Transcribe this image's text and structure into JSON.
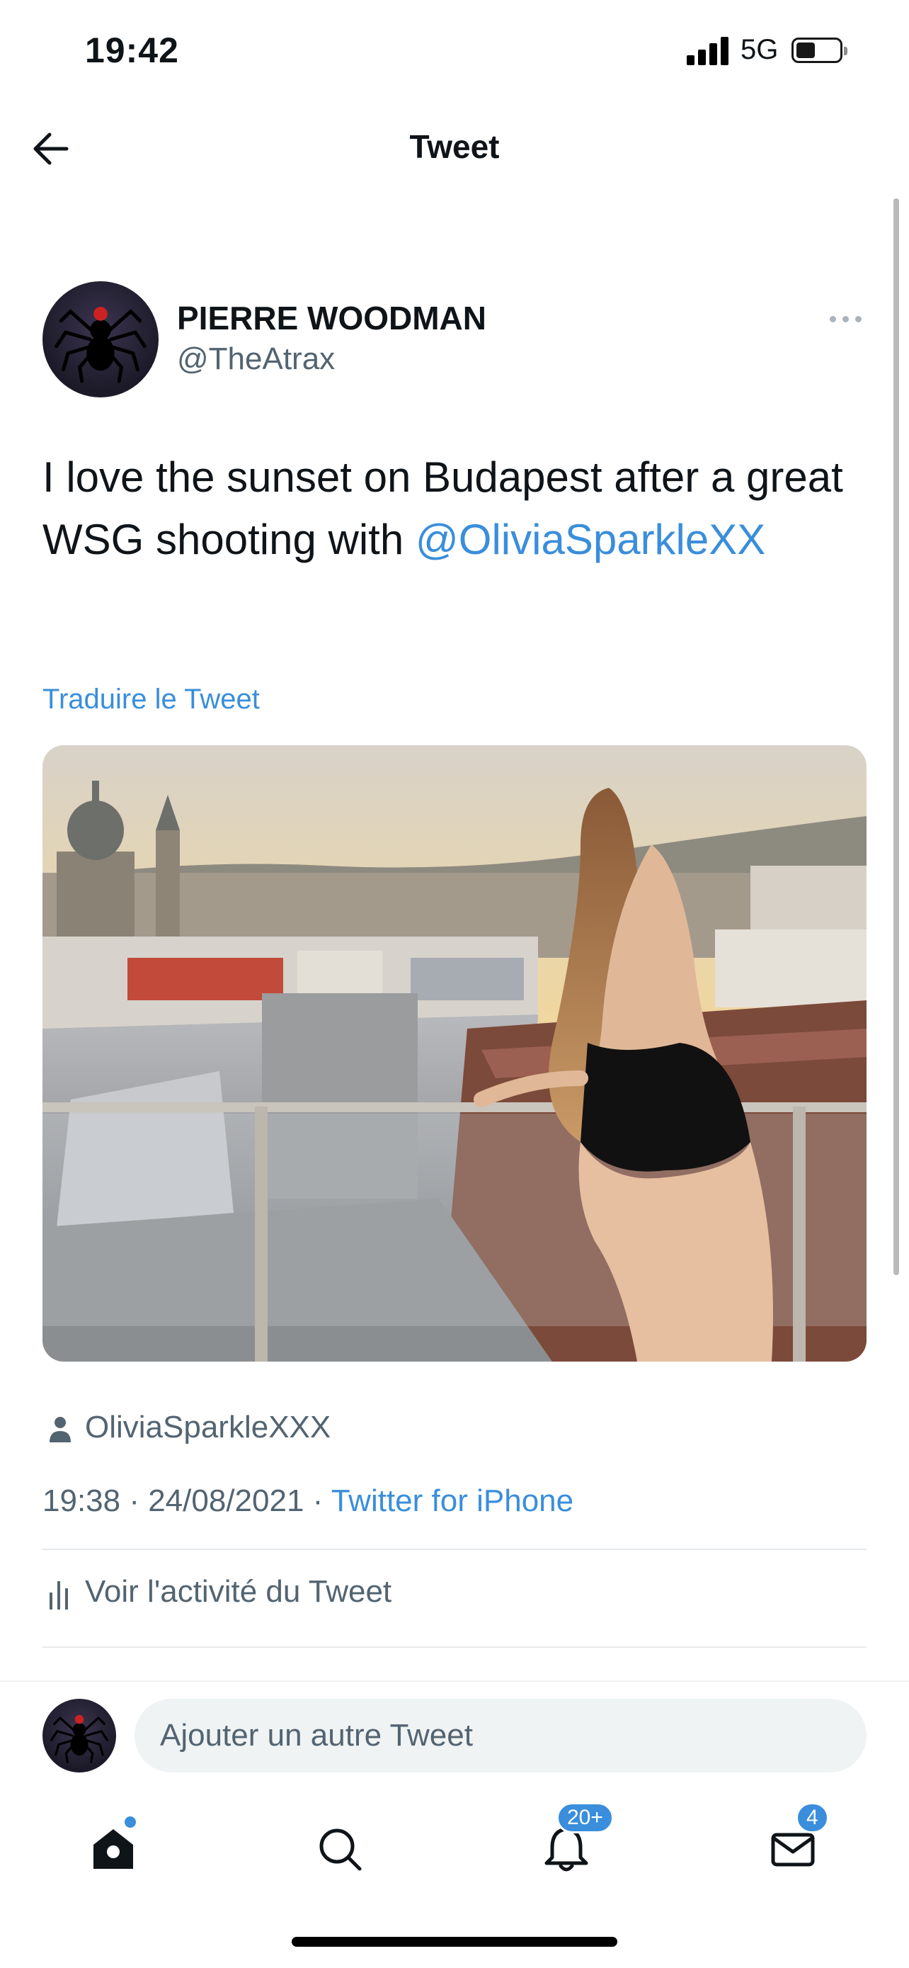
{
  "status_bar": {
    "time": "19:42",
    "network": "5G",
    "icons": [
      "signal-icon",
      "battery-icon"
    ]
  },
  "header": {
    "title": "Tweet",
    "back_icon": "arrow-left-icon"
  },
  "tweet": {
    "author_name": "PIERRE WOODMAN",
    "author_handle": "@TheAtrax",
    "text_before": "I love the sunset on Budapest after a great WSG shooting with ",
    "mention": "@OliviaSparkleXX",
    "translate_label": "Traduire le Tweet",
    "tagged_user": "OliviaSparkleXXX",
    "timestamp": "19:38 · 24/08/2021 · ",
    "source": "Twitter for iPhone",
    "activity_label": "Voir l'activité du Tweet"
  },
  "reply": {
    "placeholder": "Ajouter un autre Tweet"
  },
  "tabs": [
    {
      "name": "home",
      "icon": "home-icon",
      "has_dot": true
    },
    {
      "name": "search",
      "icon": "search-icon"
    },
    {
      "name": "notifications",
      "icon": "bell-icon",
      "badge": "20+"
    },
    {
      "name": "messages",
      "icon": "mail-icon",
      "badge": "4"
    }
  ],
  "colors": {
    "accent": "#3a8edb",
    "secondary_text": "#536471",
    "primary_text": "#0f1419"
  }
}
